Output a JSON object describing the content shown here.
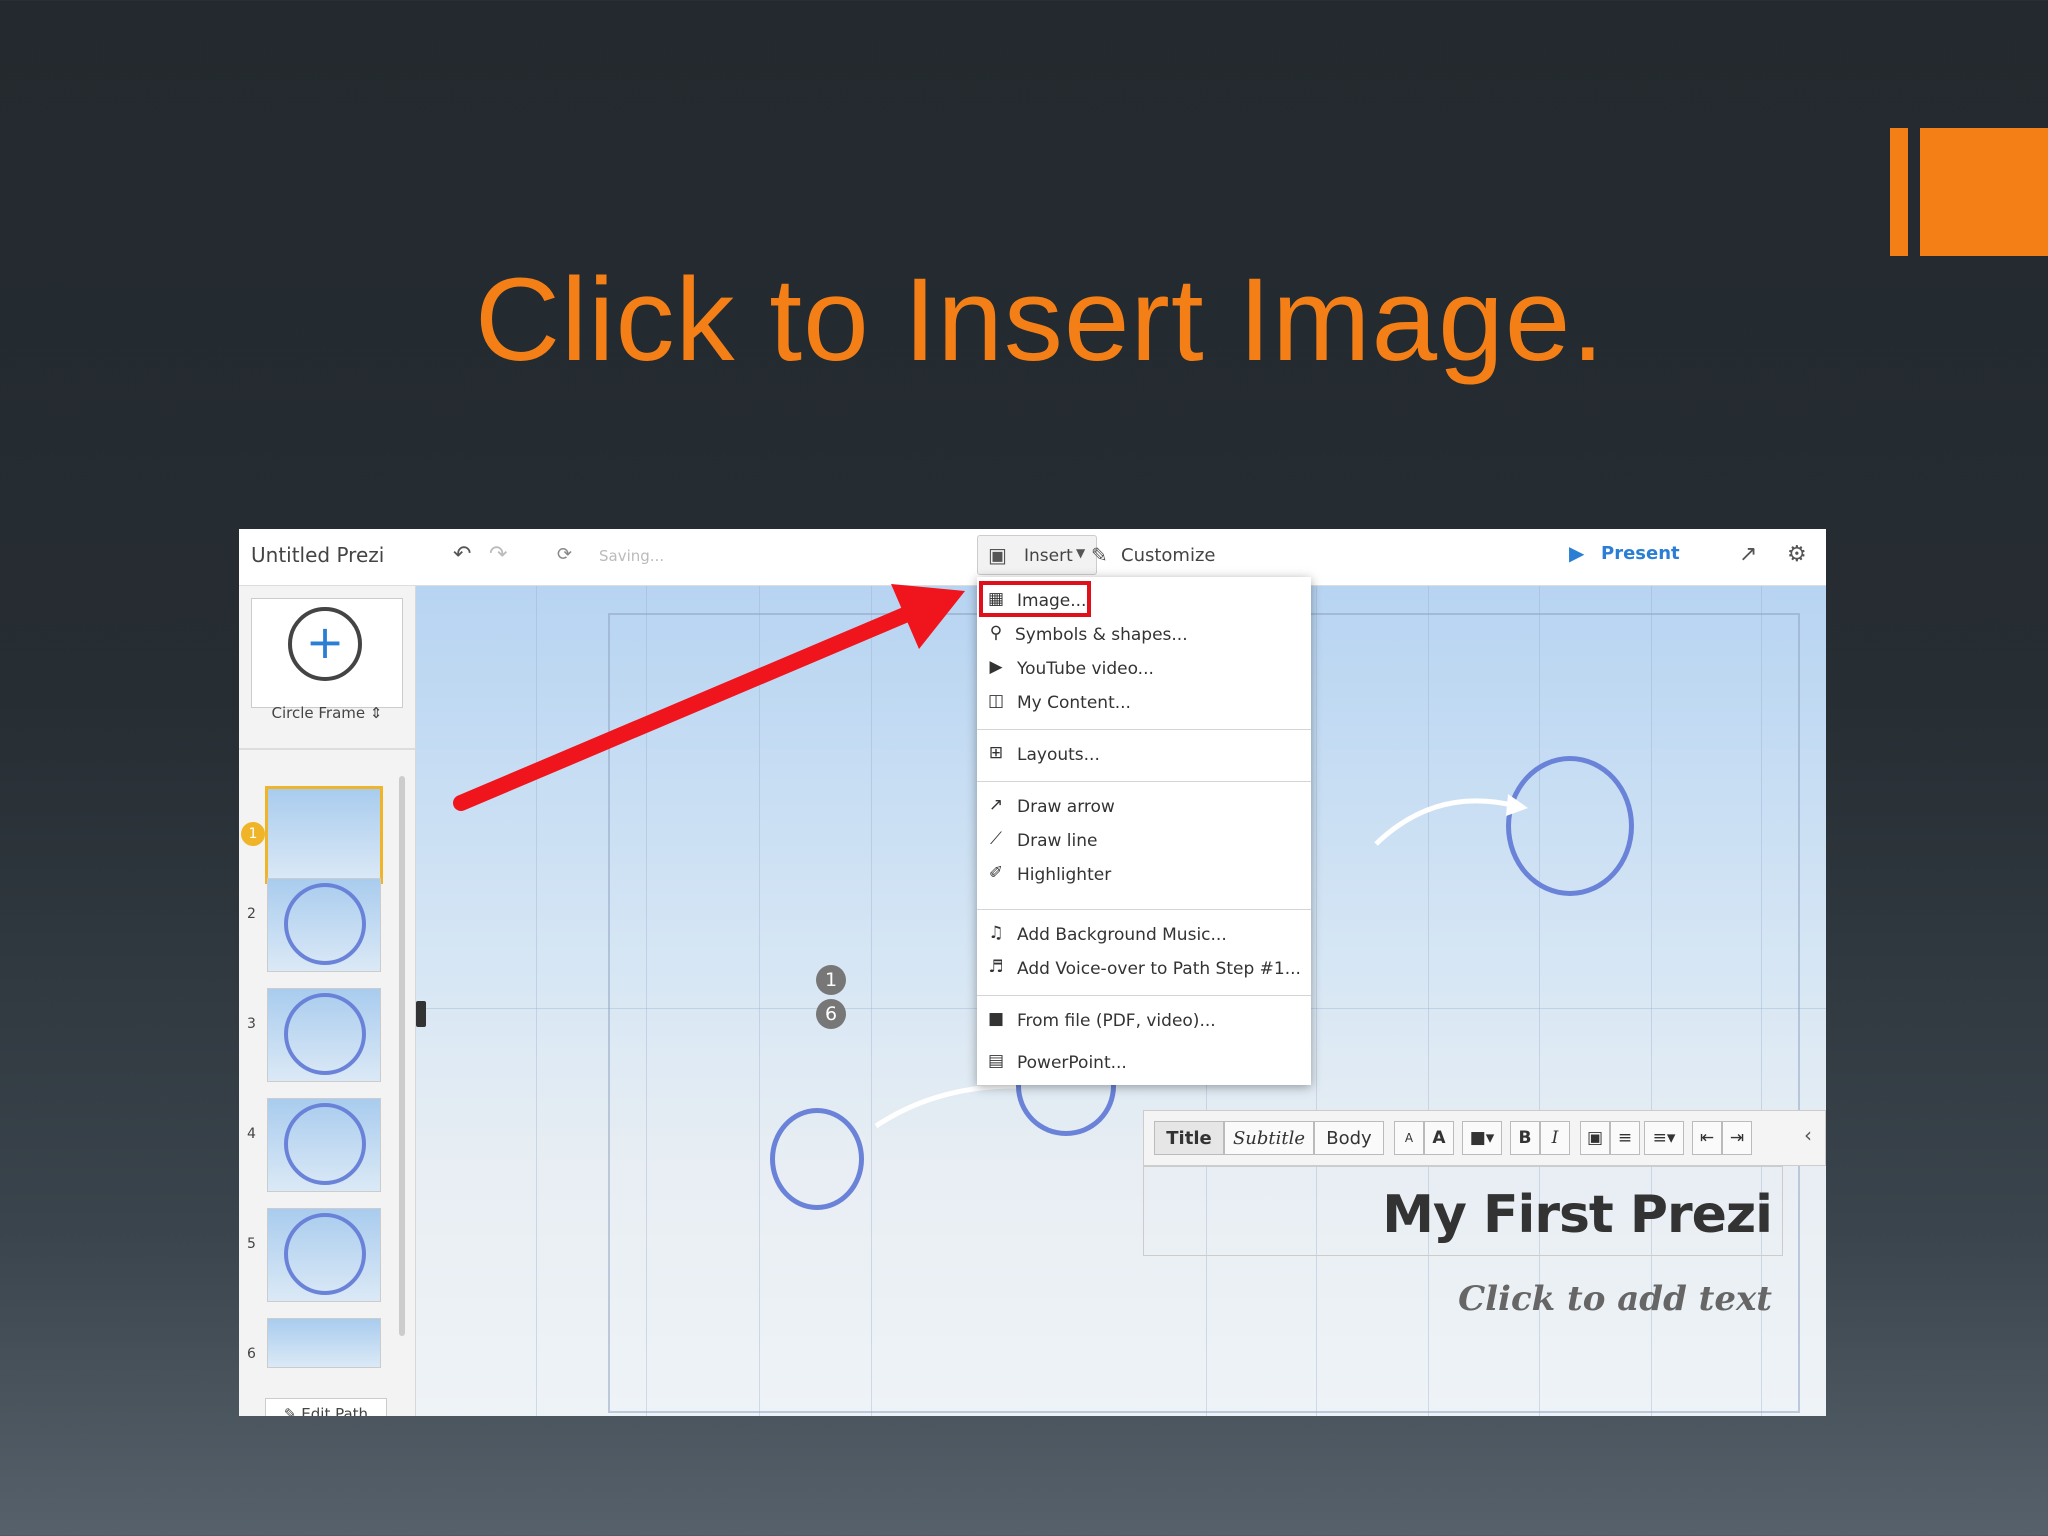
{
  "slide": {
    "title": "Click to Insert Image.",
    "accent_color": "#f57f17"
  },
  "topbar": {
    "app_title": "Untitled Prezi",
    "saving": "Saving...",
    "insert_label": "Insert",
    "customize_label": "Customize",
    "present_label": "Present"
  },
  "sidebar": {
    "frame_select": "Circle Frame",
    "thumbnails": [
      "1",
      "2",
      "3",
      "4",
      "5",
      "6"
    ],
    "edit_path": "Edit Path"
  },
  "insert_menu": {
    "items": [
      {
        "label": "Image...",
        "icon": "image-icon"
      },
      {
        "label": "Symbols & shapes...",
        "icon": "lightbulb-icon"
      },
      {
        "label": "YouTube video...",
        "icon": "play-icon"
      },
      {
        "label": "My Content...",
        "icon": "archive-icon"
      },
      {
        "label": "Layouts...",
        "icon": "layouts-icon"
      },
      {
        "label": "Draw arrow",
        "icon": "arrow-icon"
      },
      {
        "label": "Draw line",
        "icon": "line-icon"
      },
      {
        "label": "Highlighter",
        "icon": "highlighter-icon"
      },
      {
        "label": "Add Background Music...",
        "icon": "music-file-icon"
      },
      {
        "label": "Add Voice-over to Path Step #1...",
        "icon": "music-note-icon"
      },
      {
        "label": "From file (PDF, video)...",
        "icon": "folder-icon"
      },
      {
        "label": "PowerPoint...",
        "icon": "powerpoint-icon"
      }
    ]
  },
  "canvas": {
    "step_badges": [
      "1",
      "6"
    ],
    "text_toolbar": {
      "title": "Title",
      "subtitle": "Subtitle",
      "body": "Body",
      "small_a": "A",
      "large_a": "A",
      "bold": "B",
      "italic": "I"
    },
    "heading": "My First Prezi",
    "placeholder": "Click to add text"
  }
}
